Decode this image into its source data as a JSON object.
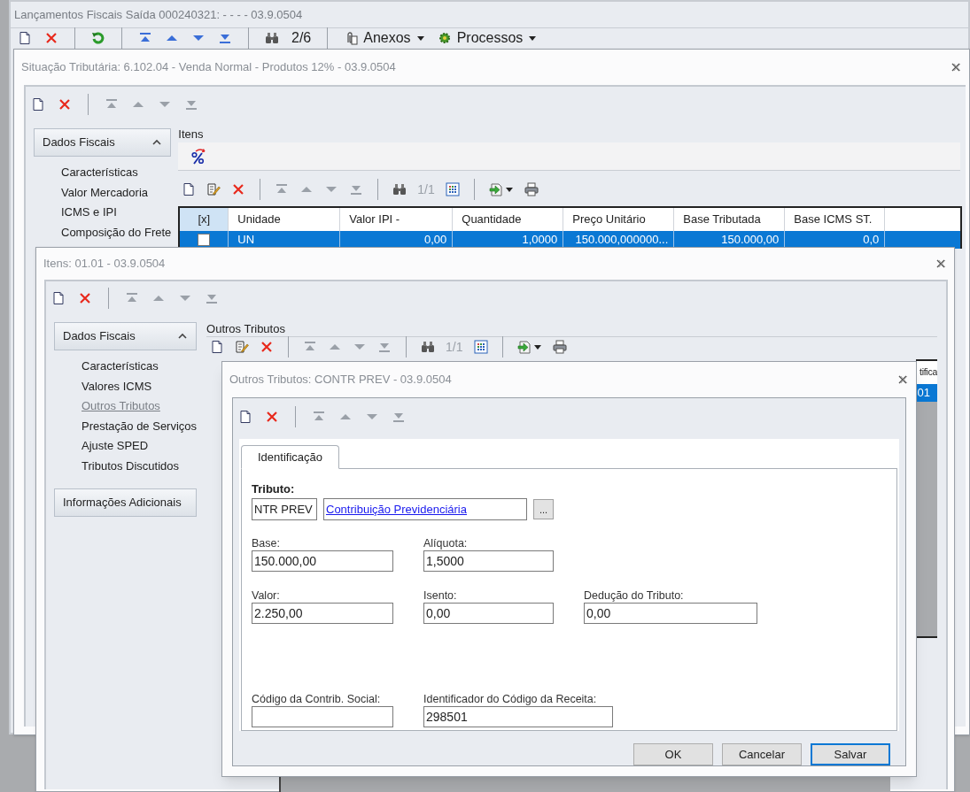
{
  "back_window": {
    "title": "Lançamentos Fiscais Saída 000240321:  - - - - 03.9.0504",
    "record_counter": "2/6",
    "menus": [
      "Anexos",
      "Processos"
    ]
  },
  "situacao_window": {
    "title": "Situação Tributária: 6.102.04 - Venda Normal - Produtos 12% - 03.9.0504",
    "sidebar": {
      "section": "Dados Fiscais",
      "expanded": true,
      "items": [
        {
          "label": "Características",
          "selected": false
        },
        {
          "label": "Valor Mercadoria",
          "selected": false
        },
        {
          "label": "ICMS e IPI",
          "selected": false
        },
        {
          "label": "Composição do Frete",
          "selected": false
        }
      ]
    },
    "group_title": "Itens",
    "record_counter": "1/1",
    "table": {
      "checkbox_column": "[x]",
      "columns": [
        "Unidade",
        "Valor IPI -",
        "Quantidade",
        "Preço Unitário",
        "Base Tributada",
        "Base ICMS ST."
      ],
      "rows": [
        {
          "selected": true,
          "checked": false,
          "cells": [
            "UN",
            "0,00",
            "1,0000",
            "150.000,000000...",
            "150.000,00",
            "0,0"
          ]
        }
      ]
    }
  },
  "itens_window": {
    "title": "Itens: 01.01 - 03.9.0504",
    "sidebar": {
      "section": "Dados Fiscais",
      "expanded": true,
      "items": [
        {
          "label": "Características",
          "selected": false
        },
        {
          "label": "Valores ICMS",
          "selected": false
        },
        {
          "label": "Outros Tributos",
          "selected": true
        },
        {
          "label": "Prestação de Serviços",
          "selected": false
        },
        {
          "label": "Ajuste SPED",
          "selected": false
        },
        {
          "label": "Tributos Discutidos",
          "selected": false
        }
      ],
      "footer_section": "Informações Adicionais"
    },
    "group_title": "Outros Tributos",
    "record_counter": "1/1",
    "table": {
      "column": "tifica",
      "rows": [
        {
          "selected": true,
          "cell": "01"
        }
      ]
    }
  },
  "dialog": {
    "title": "Outros Tributos: CONTR PREV - 03.9.0504",
    "tabs": [
      {
        "label": "Identificação",
        "selected": true
      }
    ],
    "tributo": {
      "label": "Tributo:",
      "code": "NTR PREV",
      "description": "Contribuição Previdenciária",
      "lookup": "..."
    },
    "field_rows": [
      [
        {
          "label": "Base:",
          "value": "150.000,00"
        },
        {
          "label": "Alíquota:",
          "value": "1,5000"
        }
      ],
      [
        {
          "label": "Valor:",
          "value": "2.250,00"
        },
        {
          "label": "Isento:",
          "value": "0,00"
        },
        {
          "label": "Dedução do Tributo:",
          "value": "0,00"
        }
      ],
      [
        {
          "label": "Código da Contrib. Social:"
        },
        {
          "label": "Identificador do Código da Receita:",
          "value": "298501"
        }
      ]
    ],
    "buttons": [
      {
        "label": "OK",
        "default": false
      },
      {
        "label": "Cancelar",
        "default": false
      },
      {
        "label": "Salvar",
        "default": true
      }
    ]
  }
}
